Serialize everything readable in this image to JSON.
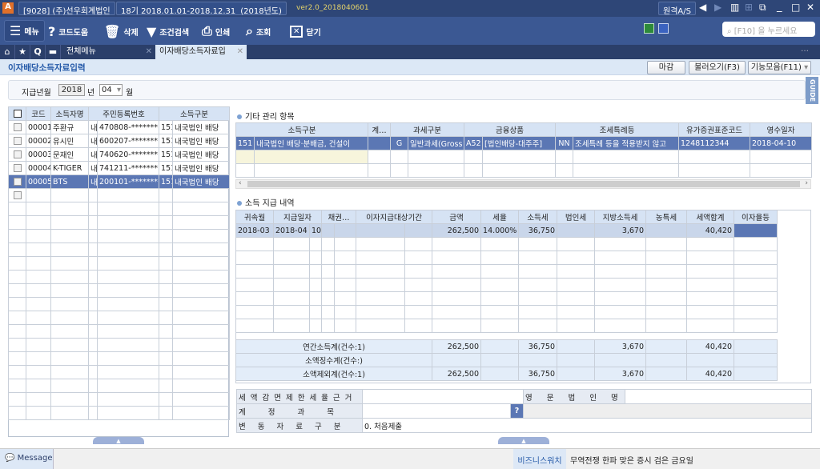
{
  "titlebar": {
    "company": "[9028] (주)선우회계법인",
    "period": "18기 2018.01.01-2018.12.31",
    "year": "(2018년도)",
    "version": "ver2.0_2018040601",
    "remote_as": "원격A/S"
  },
  "toolbar": {
    "menu": "메뉴",
    "code_help": "코드도움",
    "delete": "삭제",
    "condition_search": "조건검색",
    "print": "인쇄",
    "lookup": "조회",
    "close": "닫기",
    "search_placeholder": "[F10] 을 누르세요"
  },
  "tabs": {
    "all_menu": "전체메뉴",
    "active": "이자배당소득자료입"
  },
  "page": {
    "title": "이자배당소득자료입력",
    "btn_close_period": "마감",
    "btn_load": "불러오기(F3)",
    "btn_functions": "기능모음(F11)",
    "guide": "GUIDE"
  },
  "filter": {
    "label": "지급년월",
    "year": "2018",
    "year_unit": "년",
    "month": "04",
    "month_unit": "월"
  },
  "left_grid": {
    "headers": [
      "코드",
      "소득자명",
      "주민등록번호",
      "소득구분"
    ],
    "rows": [
      {
        "code": "00001",
        "name": "주환규",
        "kind": "내",
        "rrn": "470808-*******",
        "inc_code": "151",
        "inc": "내국법인 배당"
      },
      {
        "code": "00002",
        "name": "유시민",
        "kind": "내",
        "rrn": "600207-*******",
        "inc_code": "151",
        "inc": "내국법인 배당"
      },
      {
        "code": "00003",
        "name": "문재인",
        "kind": "내",
        "rrn": "740620-*******",
        "inc_code": "151",
        "inc": "내국법인 배당"
      },
      {
        "code": "00004",
        "name": "K-TIGER",
        "kind": "내",
        "rrn": "741211-*******",
        "inc_code": "151",
        "inc": "내국법인 배당"
      },
      {
        "code": "00005",
        "name": "BTS",
        "kind": "내",
        "rrn": "200101-*******",
        "inc_code": "151",
        "inc": "내국법인 배당",
        "selected": true
      }
    ]
  },
  "other": {
    "title": "기타 관리 항목",
    "headers": [
      "소득구분",
      "계…",
      "과세구분",
      "금융상품",
      "조세특례등",
      "유가증권표준코드",
      "영수일자"
    ],
    "row": [
      "151",
      "내국법인 배당·분배금, 건설이",
      "",
      "G",
      "일반과세(Gross",
      "A52",
      "[법인배당-대주주]",
      "NN",
      "조세특례 등을 적용받지 않고",
      "1248112344",
      "2018-04-10"
    ]
  },
  "payment": {
    "title": "소득 지급 내역",
    "headers": [
      "귀속월",
      "지급일자",
      "채권…",
      "이자지급대상기간",
      "금액",
      "세율",
      "소득세",
      "법인세",
      "지방소득세",
      "농특세",
      "세액합계",
      "이자율등"
    ],
    "row": [
      "2018-03",
      "2018-04",
      "10",
      "",
      "",
      "",
      "",
      "262,500",
      "14.000%",
      "36,750",
      "",
      "3,670",
      "",
      "40,420",
      ""
    ],
    "summary": [
      {
        "label": "연간소득계(건수:1)",
        "amount": "262,500",
        "income_tax": "36,750",
        "local_tax": "3,670",
        "total": "40,420"
      },
      {
        "label": "소액징수계(건수:)",
        "amount": "",
        "income_tax": "",
        "local_tax": "",
        "total": ""
      },
      {
        "label": "소액제외계(건수:1)",
        "amount": "262,500",
        "income_tax": "36,750",
        "local_tax": "3,670",
        "total": "40,420"
      }
    ]
  },
  "form": {
    "reduction_label": "세액감면제한세율근거",
    "reduction_value": "",
    "eng_name_label": "영문법인명",
    "eng_name_value": "",
    "account_label": "계정과목",
    "account_value": "",
    "change_label": "변동자료구분",
    "change_value": "0. 처음제출"
  },
  "status": {
    "message": "Message",
    "biz_watch_label": "비즈니스워치",
    "biz_watch_text": "무역전쟁 한파 맞은 증시 검은 금요일"
  },
  "colors": {
    "titlebar": "#2e4677",
    "toolbar": "#3b5893",
    "selected_row": "#5b77b4",
    "header": "#d6e3f4"
  }
}
